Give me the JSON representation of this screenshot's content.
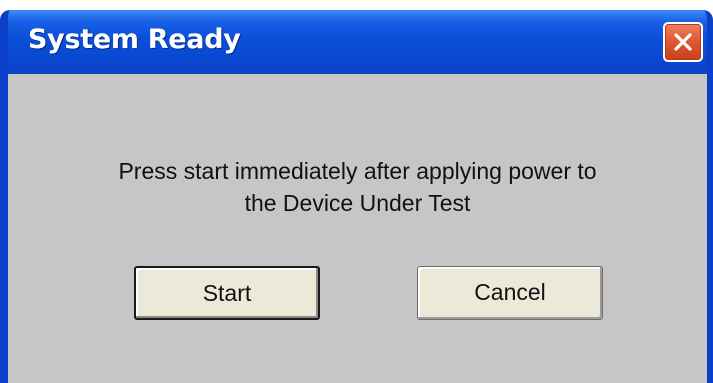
{
  "window": {
    "title": "System Ready",
    "close_icon": "close-x-icon",
    "colors": {
      "titlebar": "#0a48d2",
      "client": "#c6c6c6",
      "close_button": "#e05a34"
    }
  },
  "message": {
    "line1": "Press start immediately after applying power to",
    "line2": "the Device Under Test"
  },
  "buttons": {
    "start_label": "Start",
    "cancel_label": "Cancel"
  }
}
